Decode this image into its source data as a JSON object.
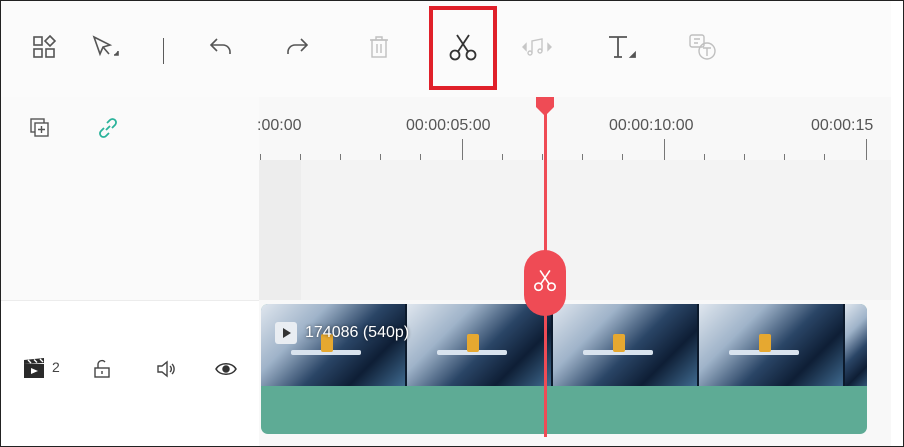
{
  "toolbar": {
    "tools": [
      {
        "name": "layout",
        "icon": "layout-grid-icon",
        "enabled": true
      },
      {
        "name": "select",
        "icon": "select-arrow-icon",
        "enabled": true
      },
      {
        "name": "undo",
        "icon": "undo-icon",
        "enabled": true
      },
      {
        "name": "redo",
        "icon": "redo-icon",
        "enabled": true
      },
      {
        "name": "delete",
        "icon": "trash-icon",
        "enabled": false
      },
      {
        "name": "split",
        "icon": "scissors-icon",
        "enabled": true,
        "highlighted": true
      },
      {
        "name": "audio",
        "icon": "audio-edit-icon",
        "enabled": false
      },
      {
        "name": "text",
        "icon": "text-tool-icon",
        "enabled": true
      },
      {
        "name": "speech-to-text",
        "icon": "speech-to-text-icon",
        "enabled": false
      }
    ],
    "highlight_color": "#e0202a"
  },
  "left_panel": {
    "top_icons": [
      "add-track-icon",
      "link-icon"
    ],
    "video_track": {
      "icon": "video-track-icon",
      "count": "2",
      "controls": [
        "lock-icon",
        "speaker-icon",
        "eye-icon"
      ]
    }
  },
  "ruler": {
    "labels": [
      ":00:00",
      "00:00:05:00",
      "00:00:10:00",
      "00:00:15"
    ]
  },
  "clip": {
    "title": "174086 (540p)",
    "accent_color": "#5eab95"
  },
  "playhead": {
    "time": "00:00:06:00",
    "color": "#ef4b55"
  }
}
